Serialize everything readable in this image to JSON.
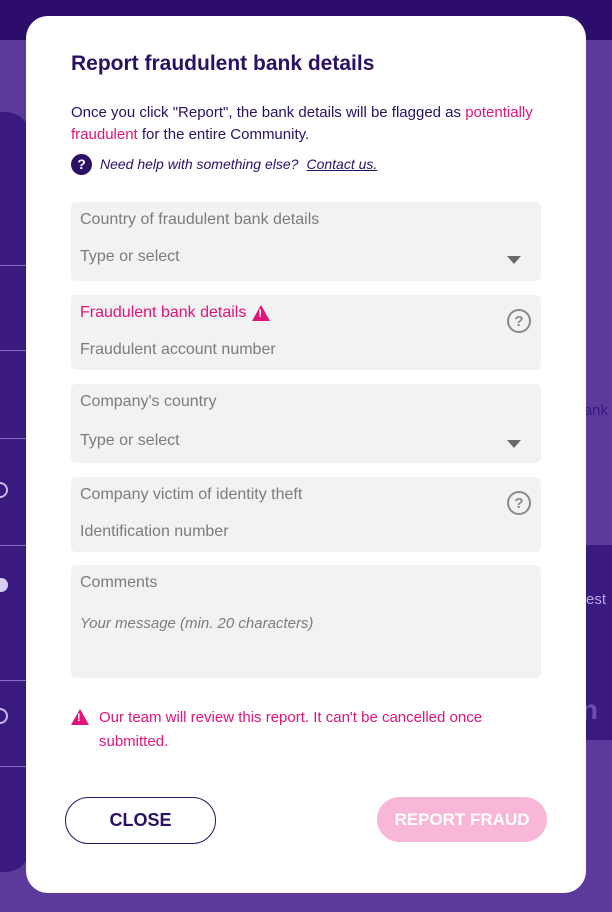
{
  "modal": {
    "title": "Report fraudulent bank details",
    "intro_prefix": "Once you click \"Report\", the bank details will be flagged as ",
    "intro_highlight": "potentially fraudulent",
    "intro_suffix": " for the entire Community.",
    "help_text": "Need help with something else?",
    "help_link": "Contact us."
  },
  "fields": {
    "country_fraud": {
      "label": "Country of fraudulent bank details",
      "placeholder": "Type or select"
    },
    "bank_details": {
      "label": "Fraudulent bank details",
      "placeholder": "Fraudulent account number"
    },
    "company_country": {
      "label": "Company's country",
      "placeholder": "Type or select"
    },
    "company_victim": {
      "label": "Company victim of identity theft",
      "placeholder": "Identification number"
    },
    "comments": {
      "label": "Comments",
      "placeholder": "Your message (min. 20 characters)"
    }
  },
  "notice": "Our team will review this report. It can't be cancelled once submitted.",
  "buttons": {
    "close": "CLOSE",
    "report": "REPORT FRAUD"
  },
  "background": {
    "right_text_1": "ank",
    "right_text_2": "est",
    "right_text_3": "n"
  },
  "colors": {
    "primary": "#2a1166",
    "accent": "#e0147a",
    "report_disabled": "#f8b7d6"
  },
  "icons": {
    "help": "question-circle-icon",
    "warning": "warning-triangle-icon",
    "dropdown": "caret-down-icon"
  }
}
